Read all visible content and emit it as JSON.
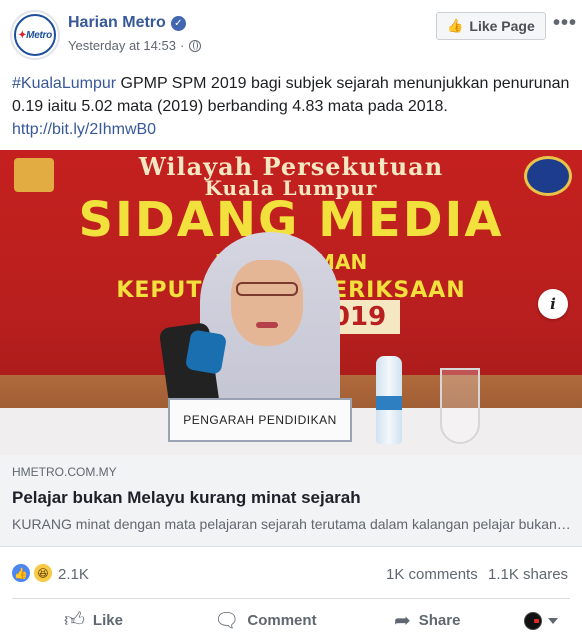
{
  "header": {
    "page_name": "Harian Metro",
    "verified_icon": "verified-check-icon",
    "timestamp": "Yesterday at 14:53",
    "separator": "·",
    "privacy_icon": "globe-icon",
    "logo_text": "Metro",
    "like_page_label": "Like Page",
    "more_icon": "more-options-icon"
  },
  "post": {
    "hashtag": "#KualaLumpur",
    "text": " GPMP SPM 2019 bagi subjek sejarah menunjukkan penurunan 0.19 iaitu 5.02 mata (2019) berbanding 4.83 mata pada 2018.",
    "link": "http://bit.ly/2IhmwB0"
  },
  "image": {
    "banner_line1": "Wilayah Persekutuan",
    "banner_line2": "Kuala Lumpur",
    "banner_line3": "SIDANG MEDIA",
    "banner_line4": "PE        UMAN",
    "banner_line5": "KEPUTU       PEPERIKSAAN",
    "year": "2019",
    "name_plate": "PENGARAH PENDIDIKAN",
    "info_label": "i"
  },
  "link_preview": {
    "domain": "HMETRO.COM.MY",
    "title": "Pelajar bukan Melayu kurang minat sejarah",
    "description": "KURANG minat dengan mata pelajaran sejarah terutama dalam kalangan pelajar bukan Melayu..."
  },
  "stats": {
    "reaction_count": "2.1K",
    "comments": "1K comments",
    "shares": "1.1K shares"
  },
  "actions": {
    "like": "Like",
    "comment": "Comment",
    "share": "Share"
  },
  "colors": {
    "link_blue": "#385898",
    "like_blue": "#4b86f2",
    "banner_red": "#c4201f",
    "banner_yellow": "#f2e03c"
  }
}
